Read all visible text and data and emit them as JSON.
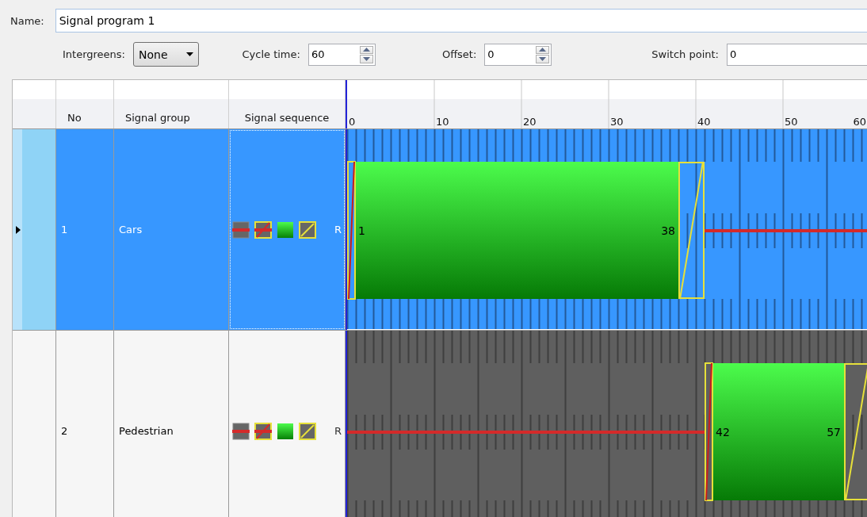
{
  "form": {
    "name_label": "Name:",
    "name_value": "Signal program 1",
    "intergreens_label": "Intergreens:",
    "intergreens_value": "None",
    "cycle_time_label": "Cycle time:",
    "cycle_time_value": "60",
    "offset_label": "Offset:",
    "offset_value": "0",
    "switch_point_label": "Switch point:",
    "switch_point_value": "0"
  },
  "table": {
    "columns": [
      "No",
      "Signal group",
      "Signal sequence"
    ],
    "timeline_ticks": [
      "0",
      "10",
      "20",
      "30",
      "40",
      "50",
      "60"
    ],
    "rows": [
      {
        "no": "1",
        "group": "Cars",
        "sequence": [
          {
            "kind": "red"
          },
          {
            "kind": "red_amber"
          },
          {
            "kind": "green"
          },
          {
            "kind": "amber"
          }
        ],
        "sequence_label": "R",
        "selected": true,
        "green_start": "1",
        "green_end": "38"
      },
      {
        "no": "2",
        "group": "Pedestrian",
        "sequence": [
          {
            "kind": "red"
          },
          {
            "kind": "red_amber"
          },
          {
            "kind": "green"
          },
          {
            "kind": "amber"
          }
        ],
        "sequence_label": "R",
        "selected": false,
        "green_start": "42",
        "green_end": "57"
      }
    ]
  }
}
